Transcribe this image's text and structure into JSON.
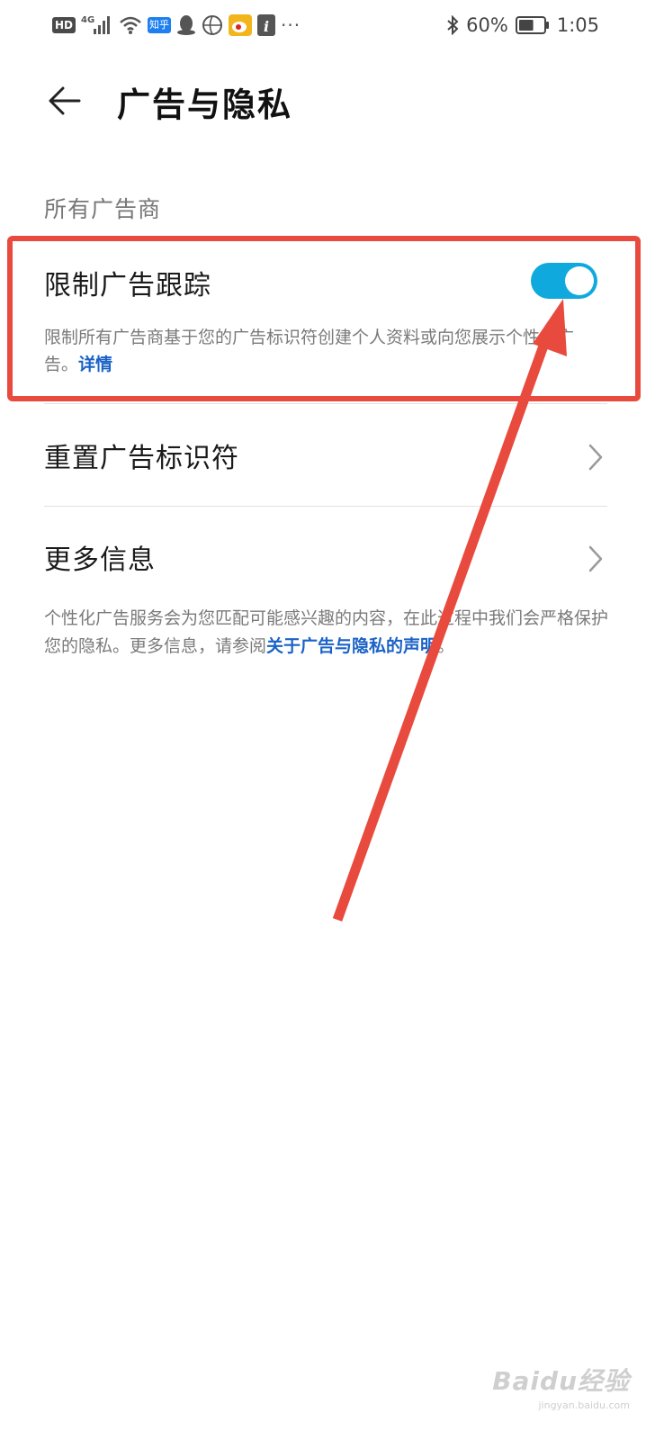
{
  "status_bar": {
    "left_icons": [
      "hd-icon",
      "signal-4g-icon",
      "wifi-icon",
      "zhihu-icon",
      "qq-icon",
      "browser-icon",
      "weibo-icon",
      "info-icon",
      "more-icon"
    ],
    "hd_label": "HD",
    "network_label": "4G",
    "zhihu_label": "知乎",
    "more_label": "···",
    "battery_percent": "60%",
    "battery_level": 0.6,
    "time": "1:05"
  },
  "header": {
    "title": "广告与隐私"
  },
  "section": {
    "label": "所有广告商"
  },
  "limit_tracking": {
    "title": "限制广告跟踪",
    "enabled": true,
    "description": "限制所有广告商基于您的广告标识符创建个人资料或向您展示个性化广告。",
    "details_link": "详情"
  },
  "rows": [
    {
      "label": "重置广告标识符"
    },
    {
      "label": "更多信息"
    }
  ],
  "footer": {
    "text": "个性化广告服务会为您匹配可能感兴趣的内容，在此过程中我们会严格保护您的隐私。更多信息，请参阅",
    "link": "关于广告与隐私的声明",
    "end": "。"
  },
  "colors": {
    "accent": "#10a9de",
    "link": "#1a62c6",
    "annotation": "#e84a3e"
  },
  "watermark": {
    "logo": "Baidu经验",
    "sub": "jingyan.baidu.com"
  }
}
